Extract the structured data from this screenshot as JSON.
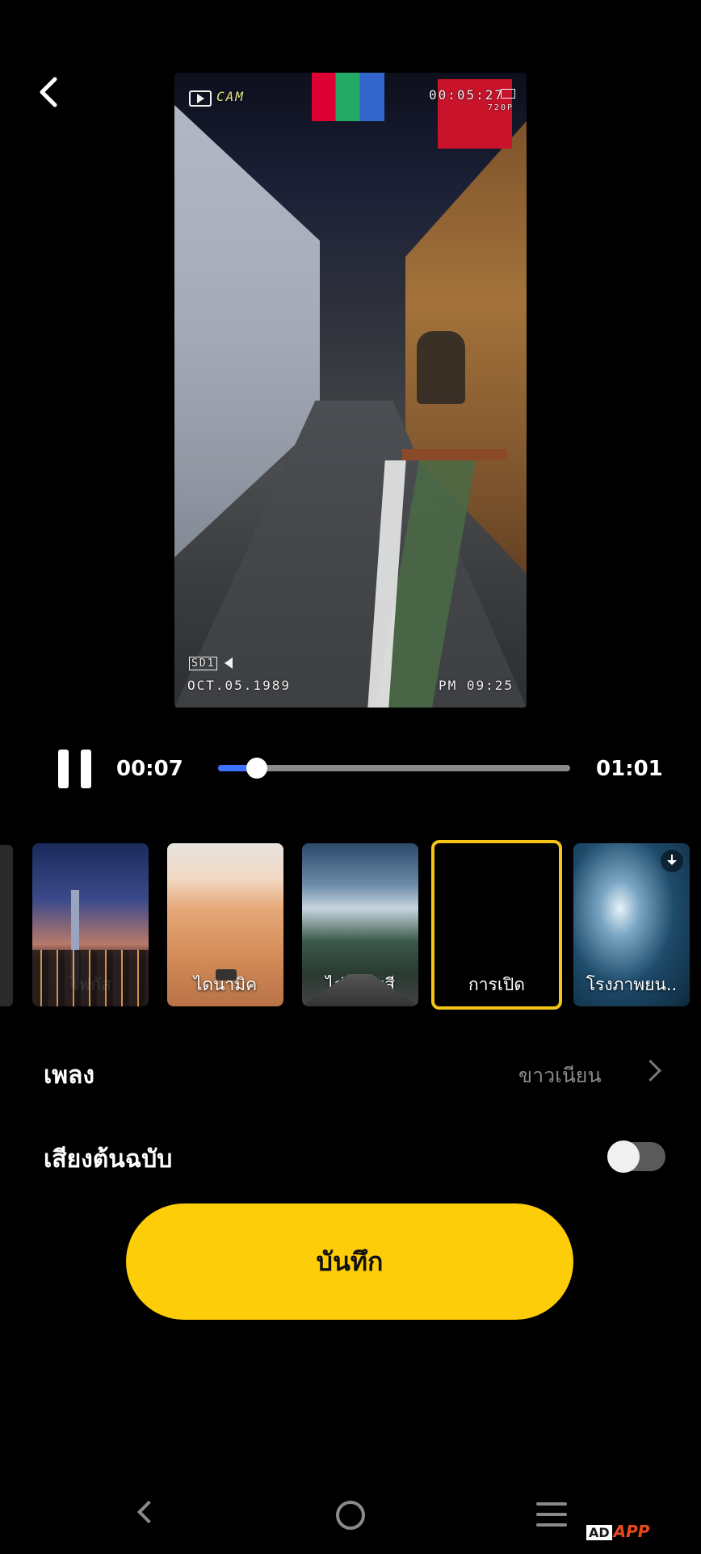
{
  "header": {
    "back_icon": "chevron-left-icon"
  },
  "video": {
    "overlay": {
      "cam_label": "CAM",
      "time_code": "00:05:27",
      "resolution": "720P",
      "sd_label": "SD1",
      "date": "OCT.05.1989",
      "clock": "PM 09:25"
    }
  },
  "playback": {
    "state": "playing",
    "current_time": "00:07",
    "total_time": "01:01",
    "progress": 0.11,
    "accent_color": "#3c72ff"
  },
  "filters": {
    "items": [
      {
        "label": "โฟกัส",
        "style": "city"
      },
      {
        "label": "ไดนามิค",
        "style": "desert"
      },
      {
        "label": "ไล่ระดับสี",
        "style": "mountain"
      },
      {
        "label": "การเปิด",
        "style": "black",
        "selected": true
      },
      {
        "label": "โรงภาพยน..",
        "style": "ocean",
        "download_icon": "download-icon"
      }
    ],
    "selected_color": "#f5c51a"
  },
  "settings": {
    "music_label": "เพลง",
    "music_value": "ขาวเนียน",
    "original_audio_label": "เสียงต้นฉบับ",
    "original_audio_enabled": false
  },
  "actions": {
    "save_label": "บันทึก",
    "save_color": "#fecd0a"
  },
  "system_nav": {
    "back_icon": "nav-back-icon",
    "home_icon": "nav-home-icon",
    "menu_icon": "nav-recents-icon"
  },
  "watermark": {
    "prefix": "AD",
    "text": "APP"
  }
}
